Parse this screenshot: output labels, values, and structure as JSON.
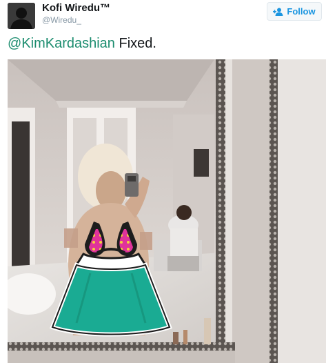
{
  "tweet": {
    "author_name": "Kofi Wiredu™",
    "author_handle": "@Wiredu_",
    "follow_label": "Follow",
    "mention": "@KimKardashian",
    "text": "Fixed."
  },
  "icons": {
    "avatar": "user-silhouette",
    "follow": "add-user-icon",
    "overlay": "bikini-and-dress-emoji"
  },
  "colors": {
    "follow_text": "#1b95e0",
    "mention": "#1b8c6e",
    "dress": "#1aab93",
    "bikini": "#e0339a"
  }
}
